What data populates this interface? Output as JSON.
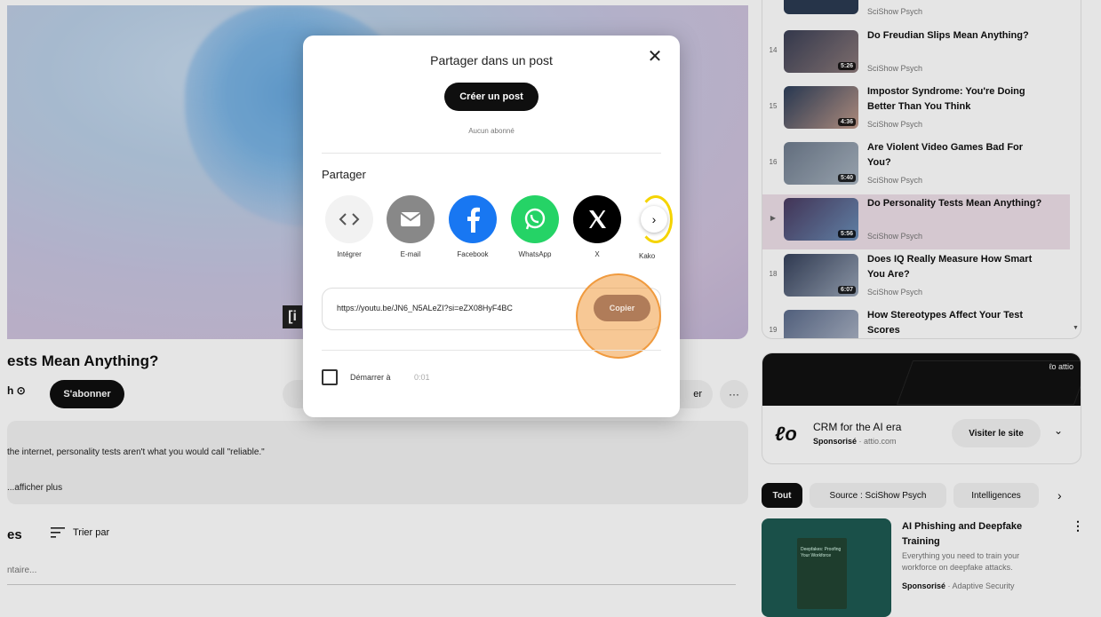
{
  "video": {
    "title": "ests Mean Anything?",
    "channel": "h ⊙",
    "subscribe_label": "S'abonner",
    "action_partial": "er",
    "more_label": "···",
    "logo_glyph": "[i"
  },
  "description": {
    "text": "the internet, personality tests aren't what you would call \"reliable.\"",
    "show_more": "...afficher plus"
  },
  "comments": {
    "heading": "es",
    "sort_label": "Trier par",
    "input_placeholder": "ntaire..."
  },
  "playlist": {
    "top_channel": "SciShow Psych",
    "items": [
      {
        "index": "14",
        "title": "Do Freudian Slips Mean Anything?",
        "channel": "SciShow Psych",
        "duration": "5:26",
        "active": false
      },
      {
        "index": "15",
        "title": "Impostor Syndrome: You're Doing Better Than You Think",
        "channel": "SciShow Psych",
        "duration": "4:36",
        "active": false
      },
      {
        "index": "16",
        "title": "Are Violent Video Games Bad For You?",
        "channel": "SciShow Psych",
        "duration": "5:40",
        "active": false
      },
      {
        "index": "▶",
        "title": "Do Personality Tests Mean Anything?",
        "channel": "SciShow Psych",
        "duration": "5:56",
        "active": true
      },
      {
        "index": "18",
        "title": "Does IQ Really Measure How Smart You Are?",
        "channel": "SciShow Psych",
        "duration": "6:07",
        "active": false
      },
      {
        "index": "19",
        "title": "How Stereotypes Affect Your Test Scores",
        "channel": "",
        "duration": "",
        "active": false
      }
    ],
    "scroll_glyph": "▼"
  },
  "ad": {
    "banner_logo": "ℓo attio",
    "logo_glyph": "ℓo",
    "title": "CRM for the AI era",
    "sponsored_label": "Sponsorisé",
    "domain": " · attio.com",
    "visit_label": "Visiter le site",
    "chevron": "⌄"
  },
  "chips": {
    "items": [
      "Tout",
      "Source : SciShow Psych",
      "Intelligences"
    ],
    "next": "›"
  },
  "sponsored_video": {
    "title": "AI Phishing and Deepfake Training",
    "description": "Everything you need to train your workforce on deepfake attacks.",
    "sponsored_label": "Sponsorisé",
    "advertiser": " · Adaptive Security",
    "thumb_text": "Deepfakes: Proofing Your Workforce",
    "menu": "⋮"
  },
  "share_dialog": {
    "title": "Partager dans un post",
    "close": "✕",
    "create_post_label": "Créer un post",
    "no_subscribers": "Aucun abonné",
    "share_label": "Partager",
    "options": [
      {
        "name": "Intégrer",
        "icon": "embed-icon",
        "color": "#f2f2f2"
      },
      {
        "name": "E-mail",
        "icon": "email-icon",
        "color": "#888888"
      },
      {
        "name": "Facebook",
        "icon": "facebook-icon",
        "color": "#1877f2"
      },
      {
        "name": "WhatsApp",
        "icon": "whatsapp-icon",
        "color": "#25d366"
      },
      {
        "name": "X",
        "icon": "x-icon",
        "color": "#000000"
      }
    ],
    "partial_option": "Kako",
    "next_arrow": "›",
    "url": "https://youtu.be/JN6_N5ALeZI?si=eZX08HyF4BC",
    "copy_label": "Copier",
    "start_label": "Démarrer à",
    "start_time": "0:01"
  }
}
